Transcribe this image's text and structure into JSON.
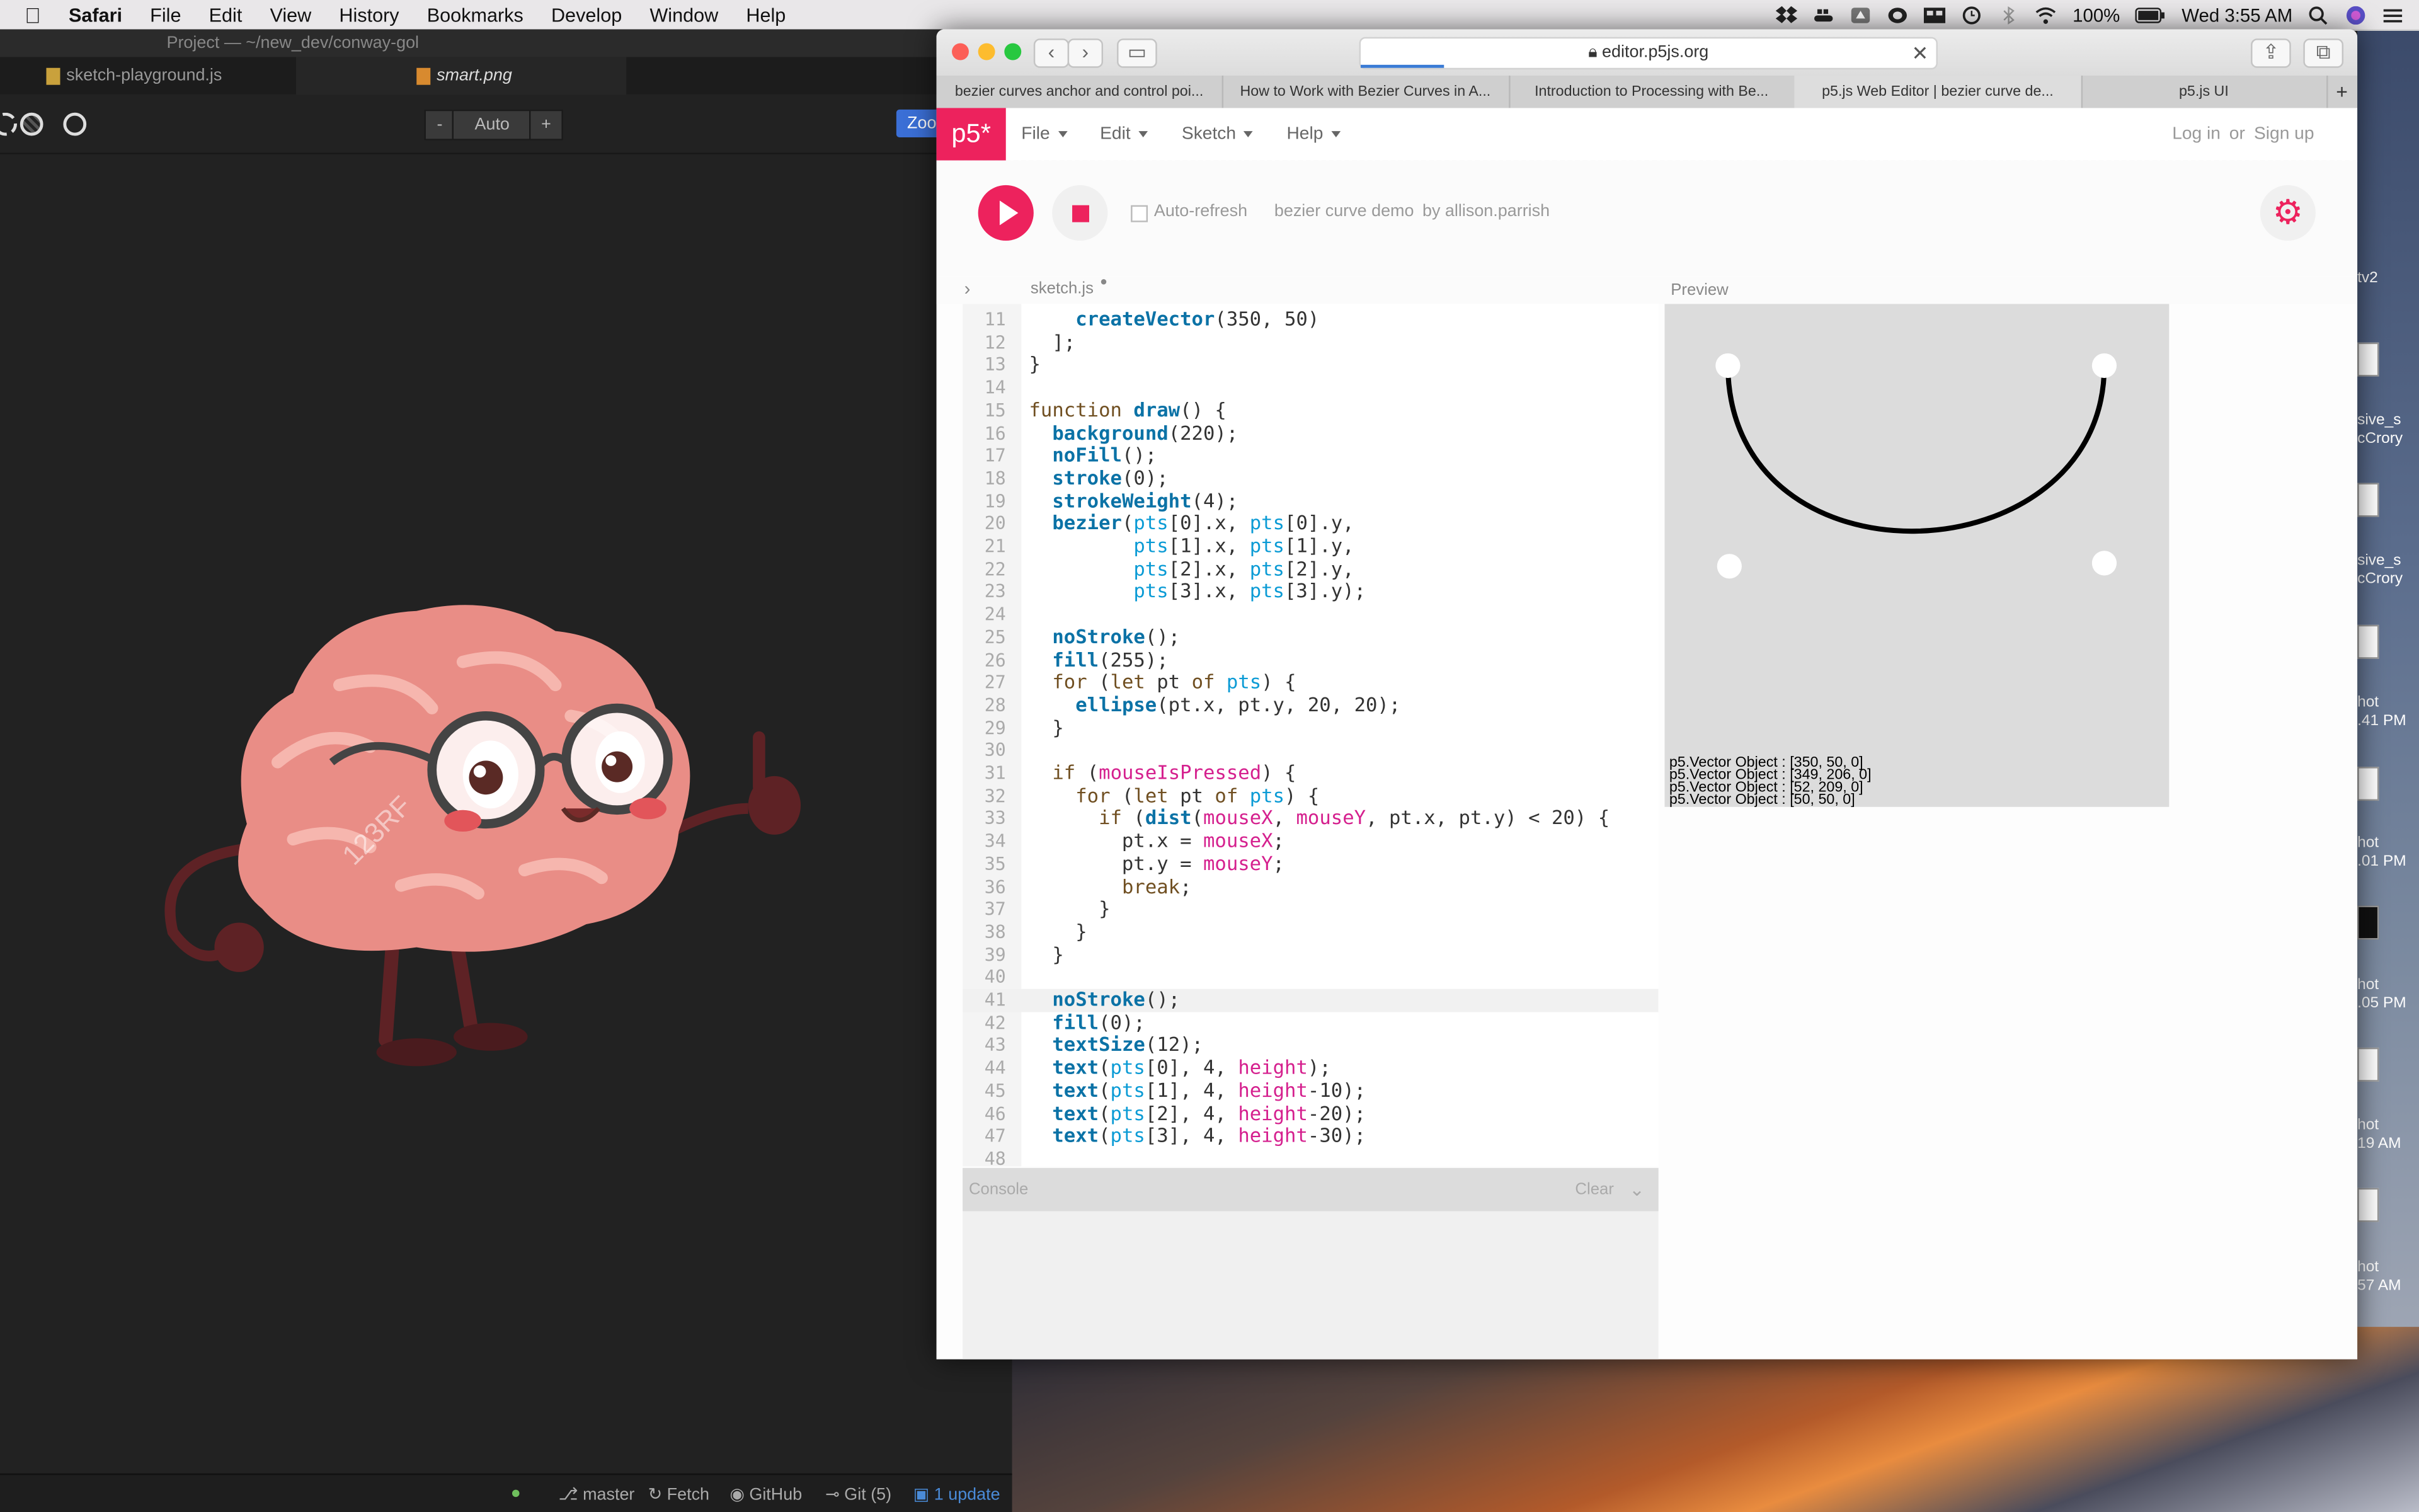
{
  "menubar": {
    "app": "Safari",
    "items": [
      "File",
      "Edit",
      "View",
      "History",
      "Bookmarks",
      "Develop",
      "Window",
      "Help"
    ],
    "battery": "100%",
    "clock": "Wed 3:55 AM"
  },
  "editor": {
    "window_title": "Project — ~/new_dev/conway-gol",
    "tabs": [
      "sketch-playground.js",
      "smart.png"
    ],
    "zoom": {
      "minus": "-",
      "value": "Auto",
      "plus": "+",
      "fit": "Zoom to fit"
    },
    "status": {
      "branch": "master",
      "fetch": "Fetch",
      "github": "GitHub",
      "git": "Git (5)",
      "update": "1 update"
    },
    "image_watermark": "123RF"
  },
  "desktop": {
    "icons": [
      "tv2",
      "sive_s\ncCrory",
      "sive_s\ncCrory",
      "hot\n.41 PM",
      "hot\n.01 PM",
      "hot\n.05 PM",
      "hot\n19 AM",
      "hot\n57 AM"
    ]
  },
  "safari": {
    "url": "editor.p5js.org",
    "tabs": [
      "bezier curves anchor and control poi...",
      "How to Work with Bezier Curves in A...",
      "Introduction to Processing with Be...",
      "p5.js Web Editor | bezier curve de...",
      "p5.js UI"
    ],
    "active_tab": 3
  },
  "p5": {
    "logo": "p5*",
    "menus": [
      "File",
      "Edit",
      "Sketch",
      "Help"
    ],
    "auth": {
      "login": "Log in",
      "or": "or",
      "signup": "Sign up"
    },
    "auto_refresh": "Auto-refresh",
    "sketch_name": "bezier curve demo",
    "by": "by allison.parrish",
    "file": "sketch.js",
    "preview_label": "Preview",
    "console_label": "Console",
    "clear_label": "Clear",
    "accent": "#ed225d",
    "code_lines": [
      {
        "n": "11",
        "t": "    createVector(350, 50)"
      },
      {
        "n": "12",
        "t": "  ];"
      },
      {
        "n": "13",
        "t": "}"
      },
      {
        "n": "14",
        "t": ""
      },
      {
        "n": "15",
        "t": "function draw() {"
      },
      {
        "n": "16",
        "t": "  background(220);"
      },
      {
        "n": "17",
        "t": "  noFill();"
      },
      {
        "n": "18",
        "t": "  stroke(0);"
      },
      {
        "n": "19",
        "t": "  strokeWeight(4);"
      },
      {
        "n": "20",
        "t": "  bezier(pts[0].x, pts[0].y,"
      },
      {
        "n": "21",
        "t": "         pts[1].x, pts[1].y,"
      },
      {
        "n": "22",
        "t": "         pts[2].x, pts[2].y,"
      },
      {
        "n": "23",
        "t": "         pts[3].x, pts[3].y);"
      },
      {
        "n": "24",
        "t": ""
      },
      {
        "n": "25",
        "t": "  noStroke();"
      },
      {
        "n": "26",
        "t": "  fill(255);"
      },
      {
        "n": "27",
        "t": "  for (let pt of pts) {"
      },
      {
        "n": "28",
        "t": "    ellipse(pt.x, pt.y, 20, 20);"
      },
      {
        "n": "29",
        "t": "  }"
      },
      {
        "n": "30",
        "t": ""
      },
      {
        "n": "31",
        "t": "  if (mouseIsPressed) {"
      },
      {
        "n": "32",
        "t": "    for (let pt of pts) {"
      },
      {
        "n": "33",
        "t": "      if (dist(mouseX, mouseY, pt.x, pt.y) < 20) {"
      },
      {
        "n": "34",
        "t": "        pt.x = mouseX;"
      },
      {
        "n": "35",
        "t": "        pt.y = mouseY;"
      },
      {
        "n": "36",
        "t": "        break;"
      },
      {
        "n": "37",
        "t": "      }"
      },
      {
        "n": "38",
        "t": "    }"
      },
      {
        "n": "39",
        "t": "  }"
      },
      {
        "n": "40",
        "t": ""
      },
      {
        "n": "41",
        "t": "  noStroke();"
      },
      {
        "n": "42",
        "t": "  fill(0);"
      },
      {
        "n": "43",
        "t": "  textSize(12);"
      },
      {
        "n": "44",
        "t": "  text(pts[0], 4, height);"
      },
      {
        "n": "45",
        "t": "  text(pts[1], 4, height-10);"
      },
      {
        "n": "46",
        "t": "  text(pts[2], 4, height-20);"
      },
      {
        "n": "47",
        "t": "  text(pts[3], 4, height-30);"
      },
      {
        "n": "48",
        "t": ""
      }
    ],
    "preview_text": [
      "p5.Vector Object : [350, 50, 0]",
      "p5.Vector Object : [349, 206, 0]",
      "p5.Vector Object : [52, 209, 0]",
      "p5.Vector Object : [50, 50, 0]"
    ]
  }
}
